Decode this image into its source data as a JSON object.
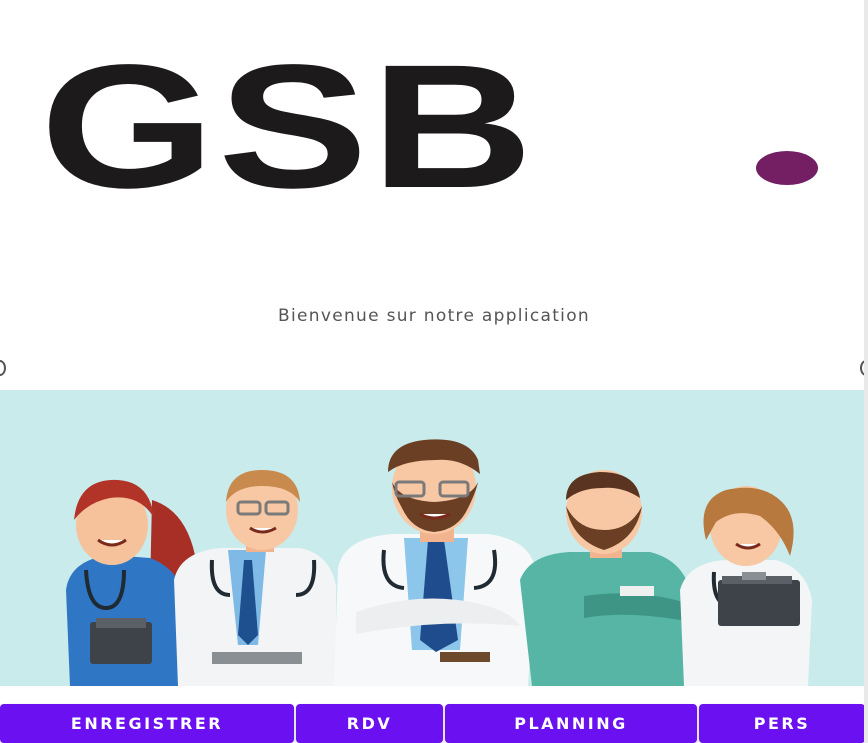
{
  "logo": {
    "text": "GSB",
    "dot_color": "#741f63"
  },
  "welcome_text": "Bienvenue sur notre application",
  "illustration": {
    "subject": "medical-team-illustration"
  },
  "nav": {
    "buttons": [
      {
        "label": "ENREGISTRER"
      },
      {
        "label": "RDV"
      },
      {
        "label": "PLANNING"
      },
      {
        "label": "PERS"
      }
    ],
    "button_color": "#6b10f0"
  }
}
